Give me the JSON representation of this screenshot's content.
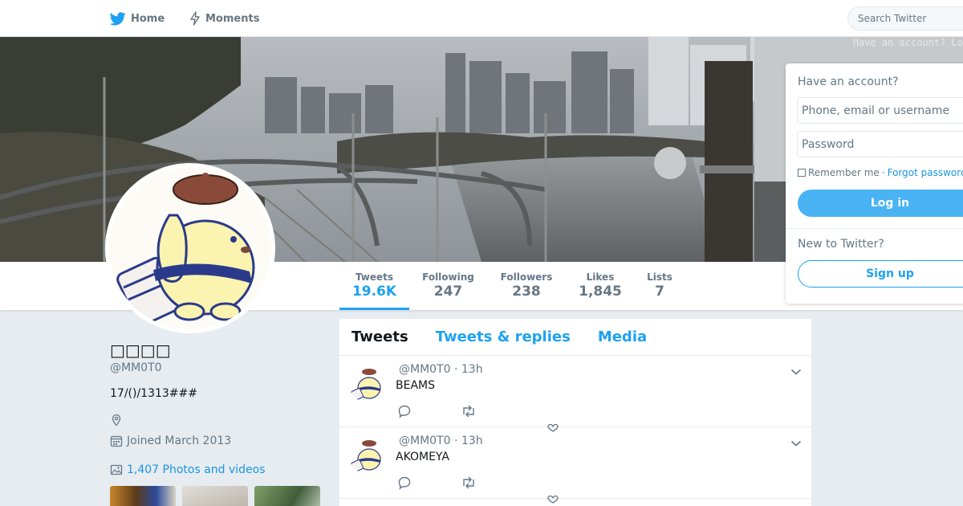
{
  "nav": {
    "home_label": "Home",
    "moments_label": "Moments",
    "search_placeholder": "Search Twitter"
  },
  "banner": {
    "overlay_text": "Have an account? Lo"
  },
  "profile": {
    "display_name": "□□□□",
    "handle": "@MM0T0",
    "bio": "17/()/1313###",
    "joined": "Joined March 2013",
    "photos_link": "1,407 Photos and videos"
  },
  "stats": [
    {
      "label": "Tweets",
      "value": "19.6K",
      "active": true
    },
    {
      "label": "Following",
      "value": "247"
    },
    {
      "label": "Followers",
      "value": "238"
    },
    {
      "label": "Likes",
      "value": "1,845"
    },
    {
      "label": "Lists",
      "value": "7"
    }
  ],
  "timeline": {
    "tabs": [
      "Tweets",
      "Tweets & replies",
      "Media"
    ],
    "tweets": [
      {
        "meta": "@MM0T0 · 13h",
        "text": "BEAMS"
      },
      {
        "meta": "@MM0T0 · 13h",
        "text": "AKOMEYA"
      }
    ]
  },
  "login": {
    "have_account": "Have an account?",
    "username_placeholder": "Phone, email or username",
    "password_placeholder": "Password",
    "remember_me": "Remember me",
    "separator": " · ",
    "forgot_password": "Forgot password?",
    "login_button": "Log in",
    "new_to_twitter": "New to Twitter?",
    "signup_button": "Sign up"
  },
  "colors": {
    "accent": "#1da1f2",
    "background": "#e6ecf0"
  }
}
